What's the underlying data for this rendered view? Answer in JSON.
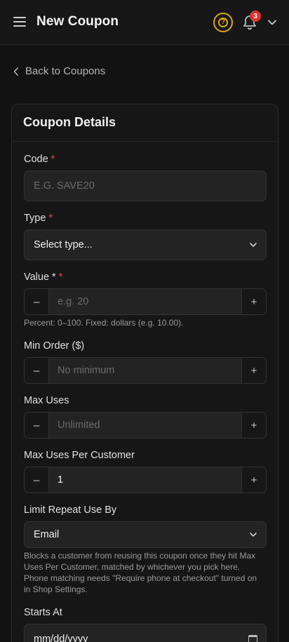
{
  "header": {
    "title": "New Coupon",
    "help_icon_label": "?",
    "notification_count": "3"
  },
  "back_link": "Back to Coupons",
  "card": {
    "title": "Coupon Details"
  },
  "fields": {
    "code": {
      "label": "Code",
      "required_mark": "*",
      "placeholder": "E.G. SAVE20"
    },
    "type": {
      "label": "Type",
      "required_mark": "*",
      "value": "Select type..."
    },
    "value": {
      "label": "Value *",
      "required_mark": "*",
      "placeholder": "e.g. 20",
      "help": "Percent: 0–100. Fixed: dollars (e.g. 10.00)."
    },
    "min_order": {
      "label": "Min Order ($)",
      "placeholder": "No minimum"
    },
    "max_uses": {
      "label": "Max Uses",
      "placeholder": "Unlimited"
    },
    "max_uses_per_customer": {
      "label": "Max Uses Per Customer",
      "value": "1"
    },
    "limit_repeat": {
      "label": "Limit Repeat Use By",
      "value": "Email",
      "help": "Blocks a customer from reusing this coupon once they hit Max Uses Per Customer, matched by whichever you pick here. Phone matching needs \"Require phone at checkout\" turned on in Shop Settings."
    },
    "starts_at": {
      "label": "Starts At",
      "value": "mm/dd/yyyy"
    }
  },
  "stepper": {
    "minus": "–",
    "plus": "+"
  },
  "colors": {
    "accent_help": "#d9a21b",
    "badge": "#e0332d",
    "required": "#e5484d"
  }
}
